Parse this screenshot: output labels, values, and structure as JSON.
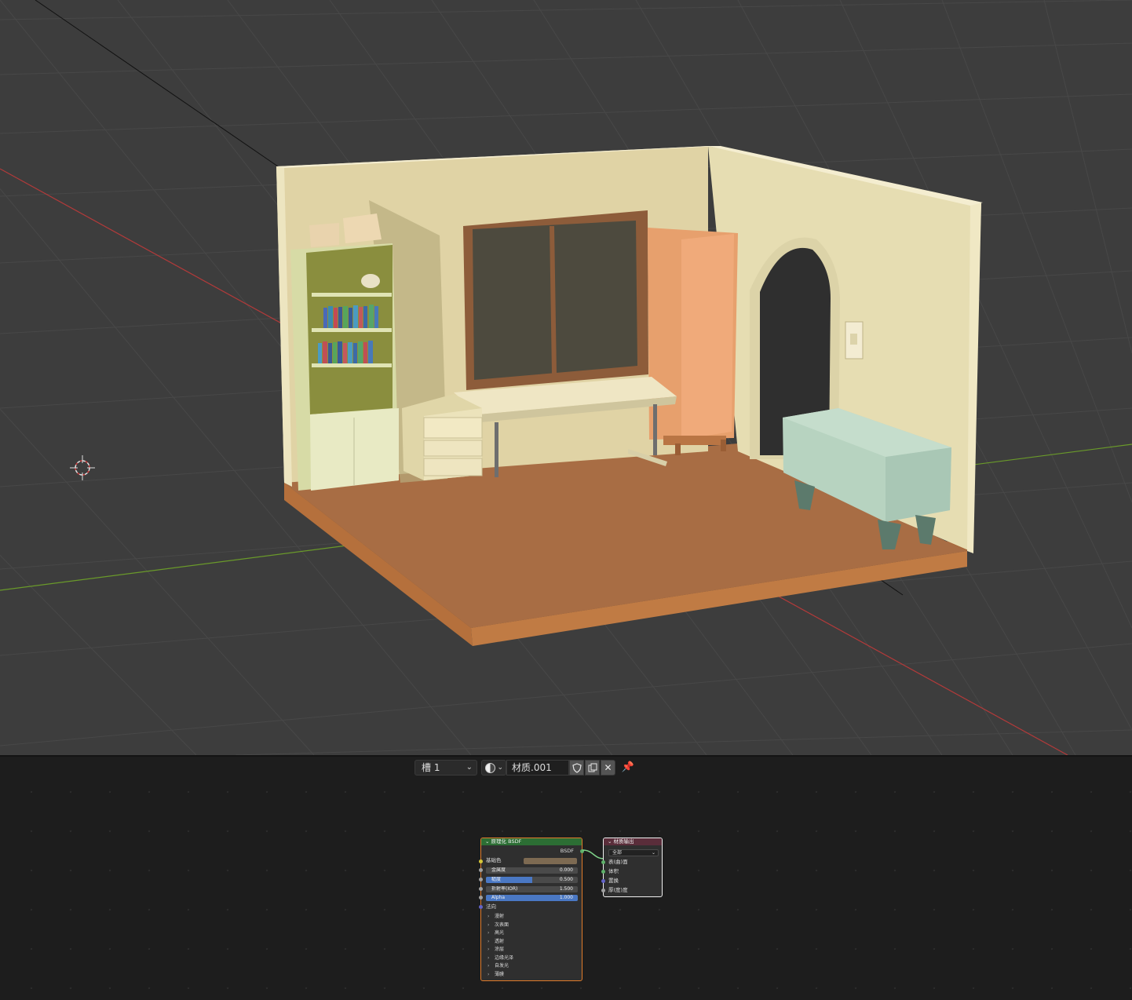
{
  "material_header": {
    "slot_label": "槽 1",
    "material_name": "材质.001"
  },
  "bsdf_node": {
    "title": "原理化 BSDF",
    "output_socket": "BSDF",
    "base_color_label": "基础色",
    "fields": [
      {
        "label": "金属度",
        "value": "0.000",
        "fraction": 0.0
      },
      {
        "label": "糙度",
        "value": "0.500",
        "fraction": 0.5
      },
      {
        "label": "折射率(IOR)",
        "value": "1.500",
        "fraction": 0.0
      },
      {
        "label": "Alpha",
        "value": "1.000",
        "fraction": 1.0
      }
    ],
    "normal_label": "法向",
    "panels": [
      "漫射",
      "次表面",
      "高光",
      "透射",
      "涂层",
      "边缘光泽",
      "自发光",
      "薄膜"
    ]
  },
  "output_node": {
    "title": "材质输出",
    "target": "全部",
    "sockets": [
      "表(曲)面",
      "体积",
      "置换",
      "厚(度)度"
    ]
  },
  "colors": {
    "viewport_bg": "#3d3d3d",
    "x_axis": "#b33a3a",
    "y_axis": "#6a9a2a",
    "bsdf_header": "#2c6e34",
    "bsdf_border": "#e07b2a",
    "field_fill": "#4a78c4"
  },
  "icons": [
    "3d-cursor-icon",
    "material-sphere-icon",
    "fake-user-shield-icon",
    "duplicate-icon",
    "close-icon",
    "pin-icon"
  ]
}
